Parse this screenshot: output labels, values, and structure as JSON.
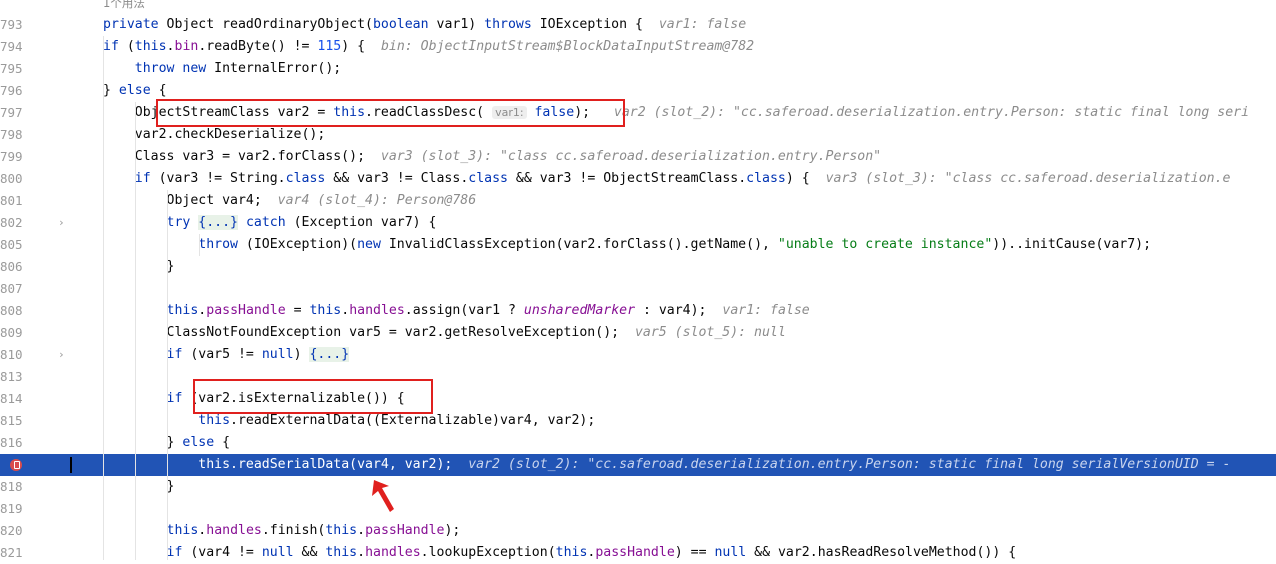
{
  "editor": {
    "usage_hint": "1个用法",
    "lines": [
      {
        "num": "793",
        "parts": [
          [
            "kw",
            "private "
          ],
          [
            "",
            "Object readOrdinaryObject("
          ],
          [
            "kw",
            "boolean "
          ],
          [
            "",
            "var1) "
          ],
          [
            "kw",
            "throws "
          ],
          [
            "",
            "IOException {  "
          ],
          [
            "dbg",
            "var1: false"
          ]
        ]
      },
      {
        "num": "794",
        "parts": [
          [
            "",
            "    "
          ],
          [
            "kw",
            "if "
          ],
          [
            "",
            "("
          ],
          [
            "kw",
            "this"
          ],
          [
            "",
            "."
          ],
          [
            "fld",
            "bin"
          ],
          [
            "",
            ".readByte() != "
          ],
          [
            "num",
            "115"
          ],
          [
            "",
            ") {  "
          ],
          [
            "dbg",
            "bin: ObjectInputStream$BlockDataInputStream@782"
          ]
        ]
      },
      {
        "num": "795",
        "parts": [
          [
            "",
            "        "
          ],
          [
            "kw",
            "throw new "
          ],
          [
            "",
            "InternalError();"
          ]
        ]
      },
      {
        "num": "796",
        "parts": [
          [
            "",
            "    } "
          ],
          [
            "kw",
            "else "
          ],
          [
            "",
            "{"
          ]
        ]
      },
      {
        "num": "797",
        "parts": [
          [
            "",
            "        ObjectStreamClass var2 = "
          ],
          [
            "kw",
            "this"
          ],
          [
            "",
            ".readClassDesc( "
          ],
          [
            "param",
            "var1:"
          ],
          [
            "kw",
            " false"
          ],
          [
            "",
            "); "
          ],
          [
            "dbg",
            "  var2 (slot_2): \"cc.saferoad.deserialization.entry.Person: static final long seri"
          ]
        ]
      },
      {
        "num": "798",
        "parts": [
          [
            "",
            "        var2.checkDeserialize();"
          ]
        ]
      },
      {
        "num": "799",
        "parts": [
          [
            "",
            "        Class var3 = var2.forClass();  "
          ],
          [
            "dbg",
            "var3 (slot_3): \"class cc.saferoad.deserialization.entry.Person\""
          ]
        ]
      },
      {
        "num": "800",
        "parts": [
          [
            "",
            "        "
          ],
          [
            "kw",
            "if "
          ],
          [
            "",
            "(var3 != String."
          ],
          [
            "kw",
            "class "
          ],
          [
            "",
            "&& var3 != Class."
          ],
          [
            "kw",
            "class "
          ],
          [
            "",
            "&& var3 != ObjectStreamClass."
          ],
          [
            "kw",
            "class"
          ],
          [
            "",
            ") {  "
          ],
          [
            "dbg",
            "var3 (slot_3): \"class cc.saferoad.deserialization.e"
          ]
        ]
      },
      {
        "num": "801",
        "parts": [
          [
            "",
            "            Object var4;  "
          ],
          [
            "dbg",
            "var4 (slot_4): Person@786"
          ]
        ]
      },
      {
        "num": "802",
        "fold": true,
        "parts": [
          [
            "",
            "            "
          ],
          [
            "kw",
            "try "
          ],
          [
            "fb",
            "{...}"
          ],
          [
            "",
            ""
          ],
          [
            "kw",
            " catch "
          ],
          [
            "",
            "(Exception var7) {"
          ]
        ]
      },
      {
        "num": "805",
        "parts": [
          [
            "",
            "                "
          ],
          [
            "kw",
            "throw "
          ],
          [
            "",
            "(IOException)("
          ],
          [
            "kw",
            "new "
          ],
          [
            "",
            "InvalidClassException(var2.forClass().getName(), "
          ],
          [
            "str",
            "\"unable to create instance\""
          ],
          [
            "",
            "))..initCause(var7);"
          ]
        ]
      },
      {
        "num": "806",
        "parts": [
          [
            "",
            "            }"
          ]
        ]
      },
      {
        "num": "807",
        "parts": []
      },
      {
        "num": "808",
        "parts": [
          [
            "",
            "            "
          ],
          [
            "kw",
            "this"
          ],
          [
            "",
            "."
          ],
          [
            "fld",
            "passHandle"
          ],
          [
            "",
            " = "
          ],
          [
            "kw",
            "this"
          ],
          [
            "",
            "."
          ],
          [
            "fld",
            "handles"
          ],
          [
            "",
            ".assign(var1 ? "
          ],
          [
            "ital",
            "unsharedMarker"
          ],
          [
            "",
            " : var4);  "
          ],
          [
            "dbg",
            "var1: false"
          ]
        ]
      },
      {
        "num": "809",
        "parts": [
          [
            "",
            "            ClassNotFoundException var5 = var2.getResolveException();  "
          ],
          [
            "dbg",
            "var5 (slot_5): null"
          ]
        ]
      },
      {
        "num": "810",
        "fold": true,
        "parts": [
          [
            "",
            "            "
          ],
          [
            "kw",
            "if "
          ],
          [
            "",
            "(var5 != "
          ],
          [
            "kw",
            "null"
          ],
          [
            "",
            ") "
          ],
          [
            "fb",
            "{...}"
          ]
        ]
      },
      {
        "num": "813",
        "parts": []
      },
      {
        "num": "814",
        "parts": [
          [
            "",
            "            "
          ],
          [
            "kw",
            "if "
          ],
          [
            "",
            "(var2.isExternalizable()) {"
          ]
        ]
      },
      {
        "num": "815",
        "parts": [
          [
            "",
            "                "
          ],
          [
            "kw",
            "this"
          ],
          [
            "",
            ".readExternalData((Externalizable)var4, var2);"
          ]
        ]
      },
      {
        "num": "816",
        "parts": [
          [
            "",
            "            } "
          ],
          [
            "kw",
            "else "
          ],
          [
            "",
            "{"
          ]
        ]
      },
      {
        "num": "817",
        "exec": true,
        "parts": [
          [
            "",
            "                "
          ],
          [
            "kw",
            "this"
          ],
          [
            "",
            ".readSerialData(var4, var2);  "
          ],
          [
            "dbg",
            "var2 (slot_2): \"cc.saferoad.deserialization.entry.Person: static final long serialVersionUID = -"
          ]
        ]
      },
      {
        "num": "818",
        "parts": [
          [
            "",
            "            }"
          ]
        ]
      },
      {
        "num": "819",
        "parts": []
      },
      {
        "num": "820",
        "parts": [
          [
            "",
            "            "
          ],
          [
            "kw",
            "this"
          ],
          [
            "",
            "."
          ],
          [
            "fld",
            "handles"
          ],
          [
            "",
            ".finish("
          ],
          [
            "kw",
            "this"
          ],
          [
            "",
            "."
          ],
          [
            "fld",
            "passHandle"
          ],
          [
            "",
            ");"
          ]
        ]
      },
      {
        "num": "821",
        "parts": [
          [
            "",
            "            "
          ],
          [
            "kw",
            "if "
          ],
          [
            "",
            "(var4 != "
          ],
          [
            "kw",
            "null "
          ],
          [
            "",
            "&& "
          ],
          [
            "kw",
            "this"
          ],
          [
            "",
            "."
          ],
          [
            "fld",
            "handles"
          ],
          [
            "",
            ".lookupException("
          ],
          [
            "kw",
            "this"
          ],
          [
            "",
            "."
          ],
          [
            "fld",
            "passHandle"
          ],
          [
            "",
            ") == "
          ],
          [
            "kw",
            "null "
          ],
          [
            "",
            "&& var2.hasReadResolveMethod()) {"
          ]
        ]
      }
    ]
  }
}
